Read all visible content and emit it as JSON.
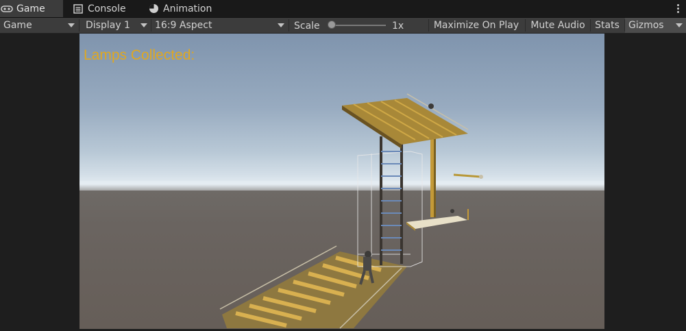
{
  "tabs": [
    {
      "label": "Game",
      "icon": "gamepad-icon",
      "active": true
    },
    {
      "label": "Console",
      "icon": "console-icon",
      "active": false
    },
    {
      "label": "Animation",
      "icon": "animation-icon",
      "active": false
    }
  ],
  "toolbar": {
    "display_mode": "Game",
    "display": "Display 1",
    "aspect": "16:9 Aspect",
    "scale_label": "Scale",
    "scale_value": "1x",
    "maximize_on_play": "Maximize On Play",
    "mute_audio": "Mute Audio",
    "stats": "Stats",
    "gizmos": "Gizmos"
  },
  "game": {
    "hud_text": "Lamps Collected:",
    "hud_color": "#e0a820"
  },
  "colors": {
    "tab_active_bg": "#3c3c3c",
    "toolbar_bg": "#3c3c3c",
    "panel_bg": "#1e1e1e"
  }
}
